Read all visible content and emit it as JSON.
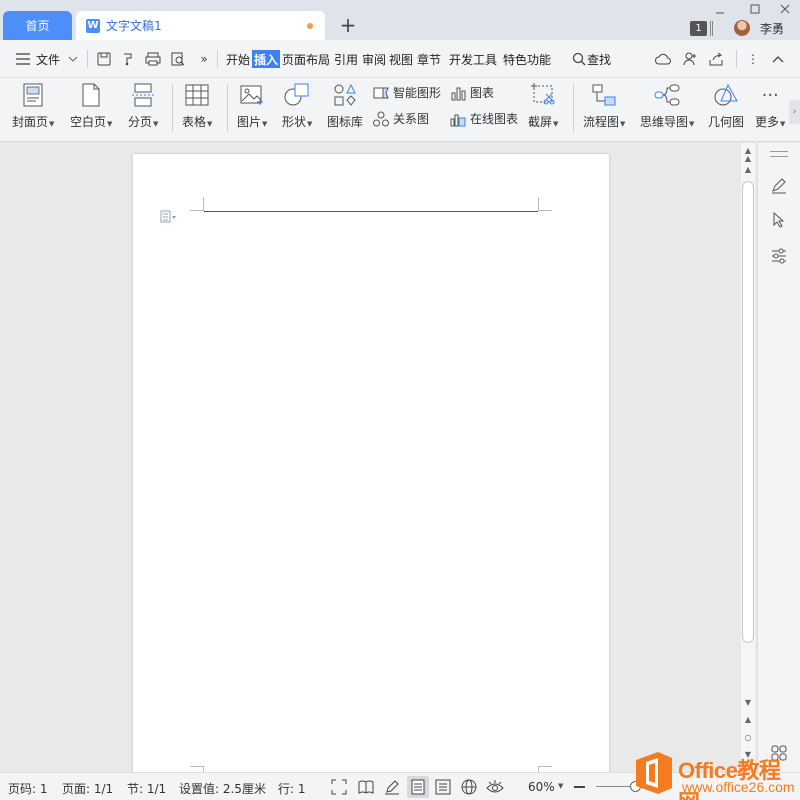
{
  "tabs": {
    "home_label": "首页",
    "doc_label": "文字文稿1",
    "doc_icon_letter": "W"
  },
  "titlebar": {
    "count_badge": "1",
    "user_name": "李勇"
  },
  "menu": {
    "file_label": "文件",
    "tabs": [
      "开始",
      "插入",
      "页面布局",
      "引用",
      "审阅",
      "视图",
      "章节",
      "开发工具",
      "特色功能"
    ],
    "active_tab": "插入",
    "search_label": "查找"
  },
  "ribbon": {
    "cover": "封面页",
    "blank": "空白页",
    "pagebreak": "分页",
    "table": "表格",
    "picture": "图片",
    "shape": "形状",
    "iconlib": "图标库",
    "smartart": "智能图形",
    "chart": "图表",
    "relation": "关系图",
    "onlinechart": "在线图表",
    "screenshot": "截屏",
    "flowchart": "流程图",
    "mindmap": "思维导图",
    "geometry": "几何图",
    "more": "更多"
  },
  "status": {
    "page_num": "页码: 1",
    "pages": "页面: 1/1",
    "section": "节: 1/1",
    "setting": "设置值: 2.5厘米",
    "row": "行: 1",
    "zoom": "60%"
  },
  "watermark": {
    "brand": "Office教程网",
    "url": "www.office26.com"
  },
  "colors": {
    "accent": "#4d8ef8",
    "active_tab": "#3b82f6",
    "watermark": "#f47b20"
  }
}
